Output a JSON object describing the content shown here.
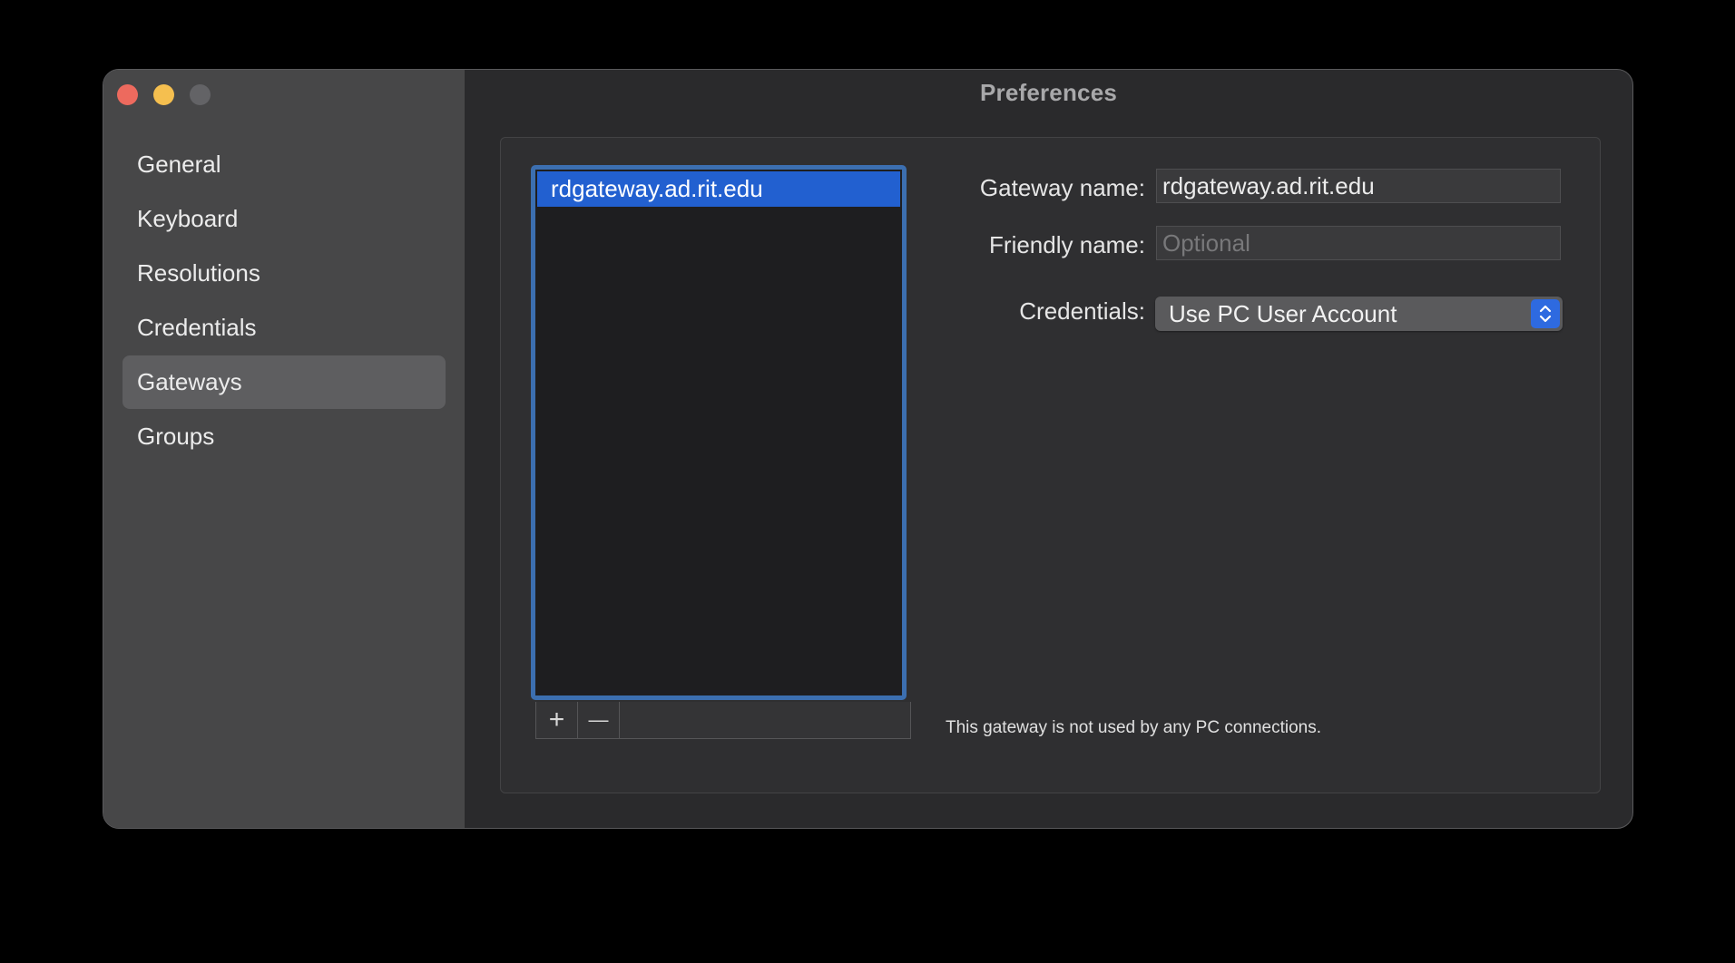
{
  "window": {
    "title": "Preferences"
  },
  "sidebar": {
    "items": [
      {
        "label": "General"
      },
      {
        "label": "Keyboard"
      },
      {
        "label": "Resolutions"
      },
      {
        "label": "Credentials"
      },
      {
        "label": "Gateways",
        "selected": true
      },
      {
        "label": "Groups"
      }
    ]
  },
  "gateways": {
    "list": [
      {
        "name": "rdgateway.ad.rit.edu",
        "selected": true
      }
    ],
    "add_symbol": "+",
    "remove_symbol": "—"
  },
  "form": {
    "gateway_name_label": "Gateway name:",
    "gateway_name_value": "rdgateway.ad.rit.edu",
    "friendly_name_label": "Friendly name:",
    "friendly_name_placeholder": "Optional",
    "credentials_label": "Credentials:",
    "credentials_value": "Use PC User Account"
  },
  "status": {
    "message": "This gateway is not used by any PC connections."
  },
  "colors": {
    "accent": "#2260d0",
    "list_focus_ring": "#3c6fb0",
    "close": "#ed6a5e",
    "minimize": "#f5bf4f"
  }
}
